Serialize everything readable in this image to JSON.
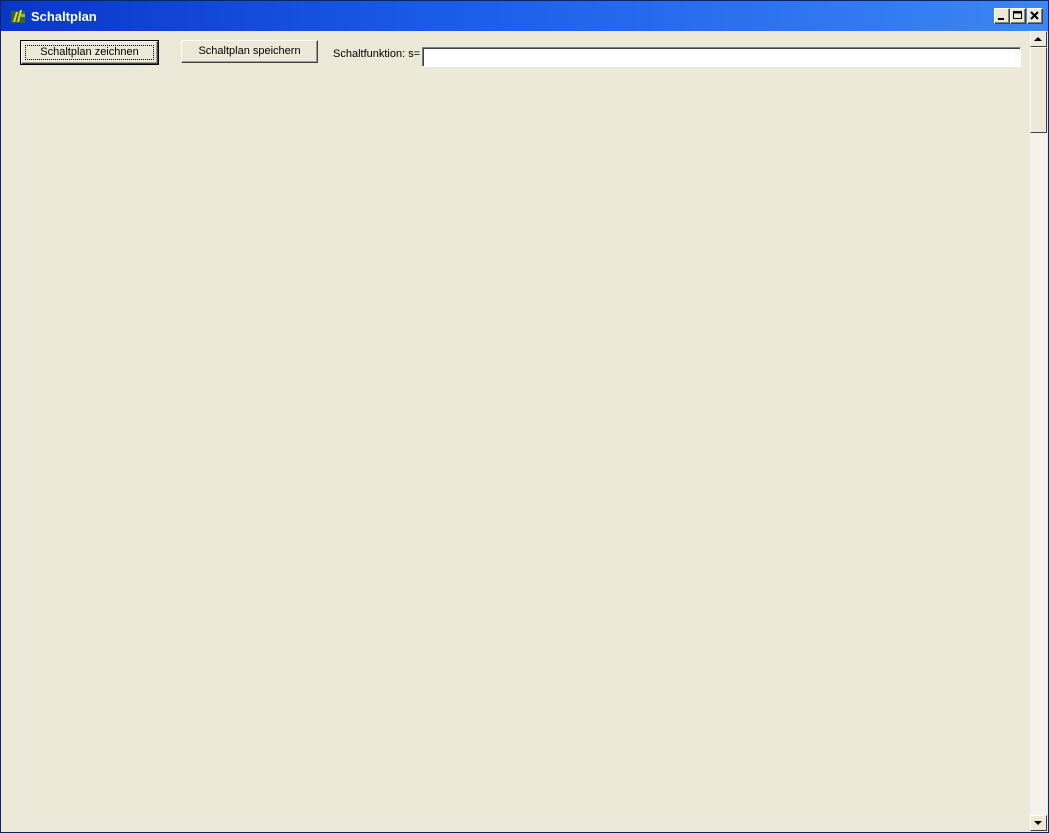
{
  "window": {
    "title": "Schaltplan",
    "icon": "app-icon"
  },
  "toolbar": {
    "draw_label": "Schaltplan zeichnen",
    "save_label": "Schaltplan speichern",
    "function_label": "Schaltfunktion: s=",
    "function_value": ""
  },
  "colors": {
    "titlebar_start": "#0A36C8",
    "titlebar_end": "#3C86F5",
    "face": "#ECE9D8"
  }
}
